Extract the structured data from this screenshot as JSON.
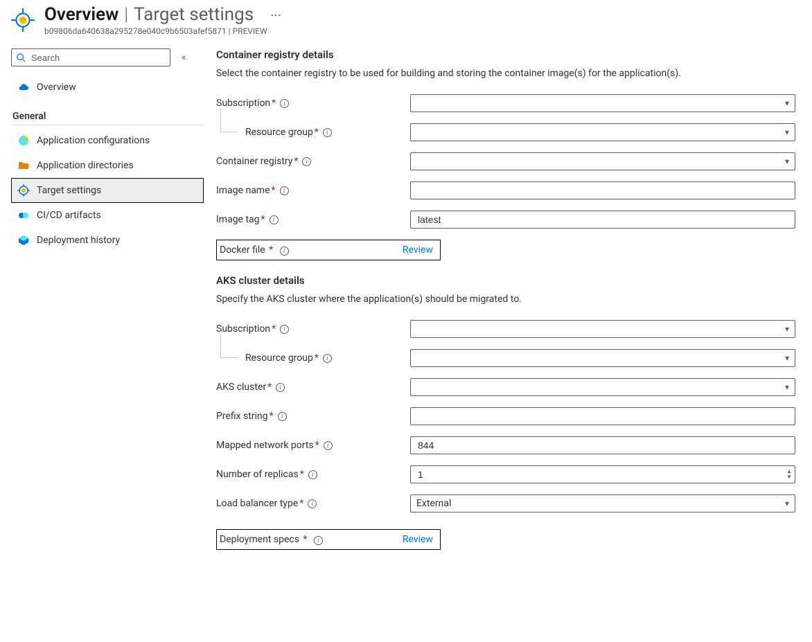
{
  "header": {
    "title": "Overview",
    "subtitle": "Target settings",
    "resource_id": "b09806da640638a295278e040c9b6503afef5871",
    "badge": "PREVIEW"
  },
  "sidebar": {
    "search_placeholder": "Search",
    "items": {
      "overview": "Overview",
      "group_general": "General",
      "app_config": "Application configurations",
      "app_dirs": "Application directories",
      "target_settings": "Target settings",
      "cicd": "CI/CD artifacts",
      "deploy_hist": "Deployment history"
    }
  },
  "sections": {
    "registry": {
      "title": "Container registry details",
      "desc": "Select the container registry to be used for building and storing the container image(s) for the application(s).",
      "labels": {
        "subscription": "Subscription",
        "resource_group": "Resource group",
        "container_registry": "Container registry",
        "image_name": "Image name",
        "image_tag": "Image tag",
        "docker_file": "Docker file"
      },
      "values": {
        "subscription": "",
        "resource_group": "",
        "container_registry": "",
        "image_name": "",
        "image_tag": "latest"
      },
      "review_label": "Review"
    },
    "aks": {
      "title": "AKS cluster details",
      "desc": "Specify the AKS cluster where the application(s) should be migrated to.",
      "labels": {
        "subscription": "Subscription",
        "resource_group": "Resource group",
        "aks_cluster": "AKS cluster",
        "prefix": "Prefix string",
        "ports": "Mapped network ports",
        "replicas": "Number of replicas",
        "lb_type": "Load balancer type",
        "deploy_specs": "Deployment specs"
      },
      "values": {
        "subscription": "",
        "resource_group": "",
        "aks_cluster": "",
        "prefix": "",
        "ports": "844",
        "replicas": "1",
        "lb_type": "External"
      },
      "review_label": "Review"
    }
  }
}
